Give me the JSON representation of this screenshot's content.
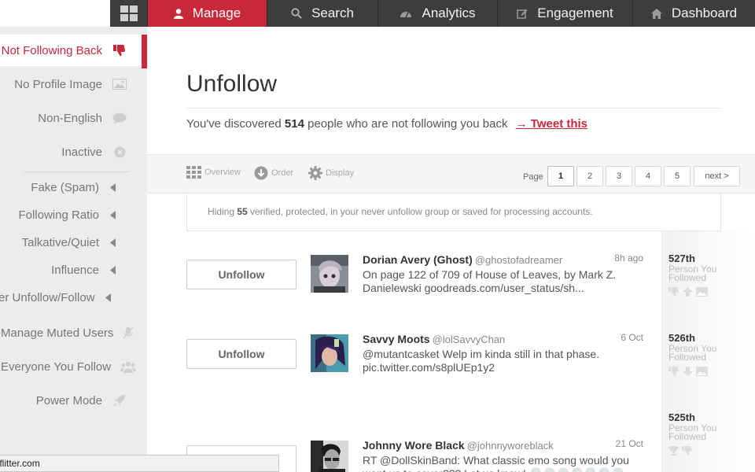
{
  "nav": {
    "tabs": [
      {
        "label": "Manage",
        "icon": "user-icon",
        "active": true
      },
      {
        "label": "Search",
        "icon": "search-icon"
      },
      {
        "label": "Analytics",
        "icon": "gauge-icon"
      },
      {
        "label": "Engagement",
        "icon": "edit-icon"
      },
      {
        "label": "Dashboard",
        "icon": "home-icon"
      }
    ]
  },
  "sidebar": {
    "items": [
      {
        "label": "Not Following Back",
        "icon": "thumbs-down-icon",
        "active": true
      },
      {
        "label": "No Profile Image",
        "icon": "image-icon"
      },
      {
        "label": "Non-English",
        "icon": "speech-bubble-icon"
      },
      {
        "label": "Inactive",
        "icon": "x-circle-icon"
      }
    ],
    "sub_items": [
      {
        "label": "Fake (Spam)"
      },
      {
        "label": "Following Ratio"
      },
      {
        "label": "Talkative/Quiet"
      },
      {
        "label": "Influence"
      },
      {
        "label": "er Unfollow/Follow"
      }
    ],
    "bottom_items": [
      {
        "label": "Manage Muted Users",
        "icon": "mute-mic-icon"
      },
      {
        "label": "Everyone You Follow",
        "icon": "users-icon"
      },
      {
        "label": "Power Mode",
        "icon": "rocket-icon"
      }
    ]
  },
  "statusbar": {
    "text": "geflitter.com"
  },
  "main": {
    "title": "Unfollow",
    "subtitle_prefix": "You've discovered ",
    "subtitle_count": "514",
    "subtitle_suffix": " people who are not following you back",
    "tweet_link": "→ Tweet this"
  },
  "toolbar": {
    "overview": "Overview",
    "order": "Order",
    "display": "Display",
    "page_label": "Page",
    "pages": [
      "1",
      "2",
      "3",
      "4",
      "5"
    ],
    "next": "next >",
    "current_page": "1"
  },
  "hiding": {
    "prefix": "Hiding ",
    "count": "55",
    "suffix": " verified, protected, in your never unfollow group or saved for processing accounts."
  },
  "unfollow_label": "Unfollow",
  "rows": [
    {
      "name": "Dorian Avery (Ghost)",
      "handle": "@ghostofadreamer",
      "time": "8h ago",
      "text": "On page 122 of 709 of House of Leaves, by Mark Z. Danielewski goodreads.com/user_status/sh...",
      "rank": "527th",
      "rank_sub": "Person You Followed"
    },
    {
      "name": "Savvy Moots",
      "handle": "@lolSavvyChan",
      "time": "6 Oct",
      "text": "@mutantcasket Welp im kinda still in that phase. pic.twitter.com/s8plUEp1y2",
      "rank": "526th",
      "rank_sub": "Person You Followed"
    },
    {
      "name": "Johnny Wore Black",
      "handle": "@johnnyworeblack",
      "time": "21 Oct",
      "text": "RT @DollSkinBand: What classic emo song would you want us to cover??? Let us know! 💀💀💀💀💀💀💀",
      "rank": "525th",
      "rank_sub": "Person You Followed"
    }
  ],
  "colors": {
    "accent": "#c8283a",
    "nav_bg": "#3d3d3d",
    "sidebar_bg": "#ececec"
  }
}
